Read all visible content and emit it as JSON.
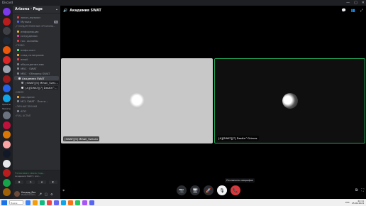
{
  "titlebar": {
    "brand": "Discord",
    "minimize_glyph": "—",
    "maximize_glyph": "▢",
    "close_glyph": "✕"
  },
  "server_rail": {
    "items": [
      {
        "color": "#7c3aed"
      },
      {
        "color": "#b91c1c"
      },
      {
        "color": "#3f3f46"
      },
      {
        "color": "#1f2937"
      },
      {
        "color": "#ea580c"
      },
      {
        "color": "#dc2626"
      },
      {
        "color": "#9ca3af"
      },
      {
        "color": "#991b1b"
      },
      {
        "color": "#2563eb"
      },
      {
        "color": "#0ea5e9"
      }
    ],
    "labels": [
      "Проекты",
      "Проекты"
    ],
    "lower_items": [
      {
        "color": "#6b7280"
      },
      {
        "color": "#be123c"
      },
      {
        "color": "#d97706"
      },
      {
        "color": "#fca5a5"
      },
      {
        "color": "#111827"
      },
      {
        "color": "#e5e7eb"
      },
      {
        "color": "#b91c1c"
      },
      {
        "color": "#16a34a"
      },
      {
        "color": "#a16207"
      }
    ]
  },
  "guild": {
    "name": "Arizona · Page",
    "menu_glyph": "⌄"
  },
  "channels": [
    {
      "type": "text",
      "label": "заказ_музыки",
      "color": "#ed4245"
    },
    {
      "type": "text",
      "label": "Музыка",
      "color": "#5865f2",
      "badge": "74"
    },
    {
      "type": "category",
      "label": "ГОСУДАРСТВЕННЫЕ ОРГАНИЗА..."
    },
    {
      "type": "text",
      "label": "информация",
      "color": "#f0b232"
    },
    {
      "type": "text",
      "label": "сотрудники",
      "color": "#eb459e"
    },
    {
      "type": "text",
      "label": "гос. жалобы",
      "color": "#ed4245"
    },
    {
      "type": "category",
      "label": "ПРАВО"
    },
    {
      "type": "text",
      "label": "инфо-лист",
      "color": "#57f287"
    },
    {
      "type": "text",
      "label": "след-телеграмм",
      "color": "#f0b232"
    },
    {
      "type": "text",
      "label": "email",
      "color": "#ed4245"
    },
    {
      "type": "text",
      "label": "обсуждение-мвс",
      "color": "#80848e"
    },
    {
      "type": "voice",
      "label": "МВС · SWAT",
      "color": "#80848e"
    },
    {
      "type": "voice",
      "label": "МВС · Обзвоны SWAT",
      "color": "#80848e"
    },
    {
      "type": "voice",
      "label": "Академия SWAT",
      "color": "#dbdee1",
      "active": true
    },
    {
      "type": "member",
      "label": "[SWAT][5] Mihail_Svec...",
      "color": "#9ca3af"
    },
    {
      "type": "member",
      "label": "[A][SWAT][7] Dastla^...",
      "color": "#e5e7eb"
    },
    {
      "type": "category",
      "label": "МВМП"
    },
    {
      "type": "text",
      "label": "мвс-пресс",
      "color": "#f0b232"
    },
    {
      "type": "voice",
      "label": "MCL SWAT · Поста...",
      "color": "#80848e"
    },
    {
      "type": "category",
      "label": "ЛИЧНЫЕ ЗВОНКИ"
    },
    {
      "type": "text",
      "label": "АТЛ",
      "color": "#80848e"
    },
    {
      "type": "category",
      "label": "FULL ACTIVE"
    }
  ],
  "voice_panel": {
    "status": "Голосовая связь под...",
    "channel": "Академия SWAT / Ariz...",
    "btn1": "◉",
    "btn2": "◎",
    "btn3": "◈",
    "btn4": "◐"
  },
  "user_panel": {
    "name": "Ульдар_бот",
    "status": "Не беспокоить",
    "mic_glyph": "🎤",
    "deafen_glyph": "🎧",
    "settings_glyph": "⚙"
  },
  "stage": {
    "title": "Академия SWAT",
    "title_glyph": "🔊",
    "header_icons": [
      "💬",
      "👥",
      "⤢"
    ],
    "tiles": [
      {
        "name": "[SWAT][5] Mihail_Svecan"
      },
      {
        "name": "[A][SWAT][7] Dastla^Grimes"
      }
    ],
    "tooltip": "Отключить микрофон",
    "controls": [
      {
        "label": "camera",
        "glyph": "📷"
      },
      {
        "label": "screen-share",
        "glyph": "🖥"
      },
      {
        "label": "activity",
        "glyph": "🚀"
      },
      {
        "label": "mute-microphone",
        "glyph": "🎙"
      },
      {
        "label": "disconnect",
        "glyph": "📞"
      }
    ],
    "activity_glyph": "⌖",
    "popout_glyphs": [
      "⧉",
      "⛶"
    ]
  },
  "taskbar": {
    "search_placeholder": "Поиск",
    "apps": [
      {
        "color": "#3b82f6"
      },
      {
        "color": "#f59e0b"
      },
      {
        "color": "#10b981"
      },
      {
        "color": "#ef4444"
      },
      {
        "color": "#6366f1"
      },
      {
        "color": "#0ea5e9"
      },
      {
        "color": "#f97316"
      },
      {
        "color": "#22c55e"
      },
      {
        "color": "#a855f7"
      },
      {
        "color": "#5865f2"
      }
    ],
    "tray": {
      "lang": "РУС",
      "time": "22:11",
      "date": "25.06.2024"
    }
  }
}
